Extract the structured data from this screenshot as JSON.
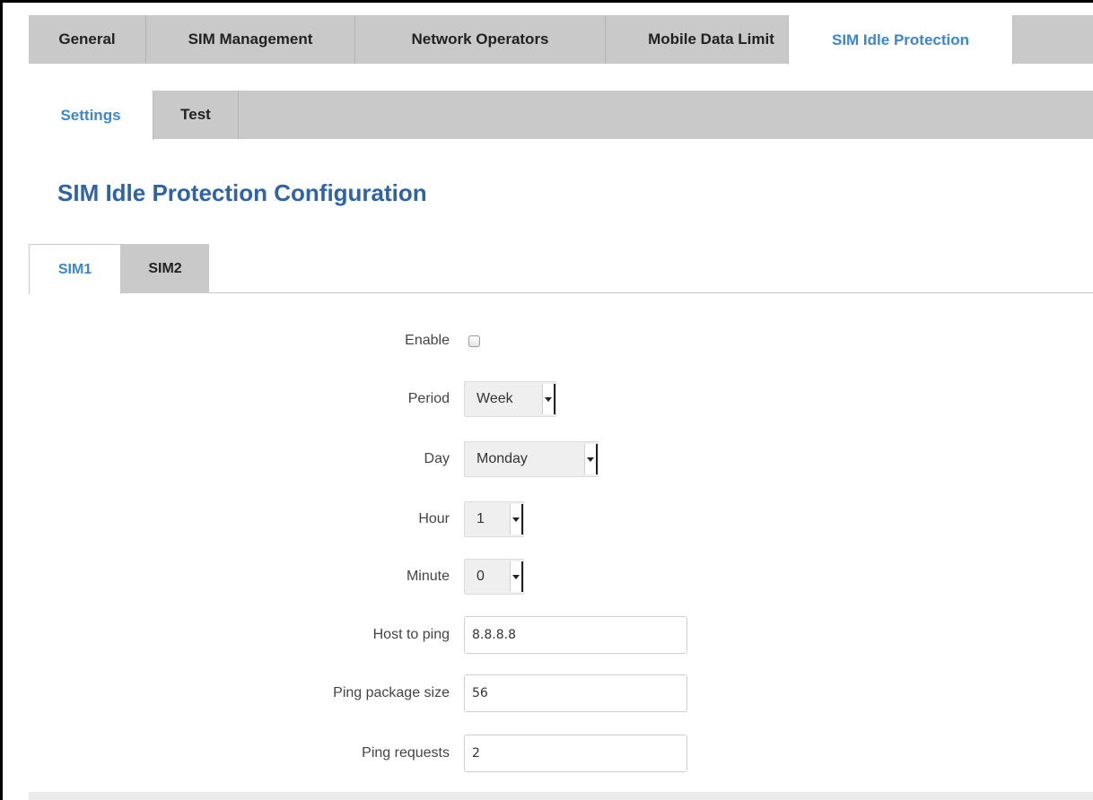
{
  "main_tabs": [
    {
      "label": "General",
      "active": false
    },
    {
      "label": "SIM Management",
      "active": false
    },
    {
      "label": "Network Operators",
      "active": false
    },
    {
      "label": "Mobile Data Limit",
      "active": false
    },
    {
      "label": "SIM Idle Protection",
      "active": true
    }
  ],
  "sub_tabs": [
    {
      "label": "Settings",
      "active": true
    },
    {
      "label": "Test",
      "active": false
    }
  ],
  "page_title": "SIM Idle Protection Configuration",
  "sim_tabs": [
    {
      "label": "SIM1",
      "active": true
    },
    {
      "label": "SIM2",
      "active": false
    }
  ],
  "form": {
    "enable": {
      "label": "Enable",
      "checked": false
    },
    "period": {
      "label": "Period",
      "value": "Week"
    },
    "day": {
      "label": "Day",
      "value": "Monday"
    },
    "hour": {
      "label": "Hour",
      "value": "1"
    },
    "minute": {
      "label": "Minute",
      "value": "0"
    },
    "host": {
      "label": "Host to ping",
      "value": "8.8.8.8"
    },
    "size": {
      "label": "Ping package size",
      "value": "56"
    },
    "requests": {
      "label": "Ping requests",
      "value": "2"
    }
  },
  "colors": {
    "accent": "#3a86d0",
    "title": "#2f63a6",
    "tab_bar": "#c9c9c9"
  }
}
